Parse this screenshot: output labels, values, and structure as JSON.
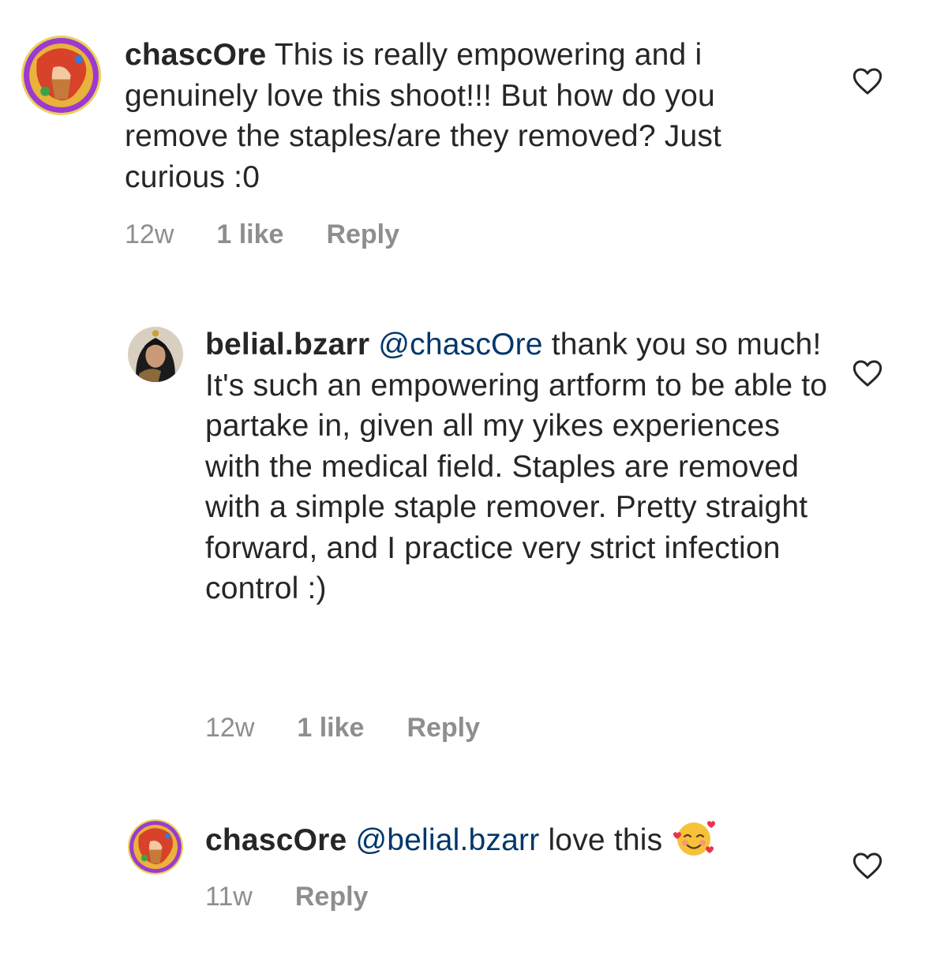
{
  "comments": [
    {
      "username": "chascOre",
      "text": "This is really empowering and i genuinely love this shoot!!! But how do you remove the staples/are they removed? Just curious :0",
      "time": "12w",
      "likes": "1 like",
      "reply_label": "Reply"
    },
    {
      "username": "belial.bzarr",
      "mention": "@chascOre",
      "text": "thank you so much! It's such an empowering artform to be able to partake in, given all my yikes experiences with the medical field. Staples are removed with a simple staple remover. Pretty straight forward, and I practice very strict infection control :)",
      "time": "12w",
      "likes": "1 like",
      "reply_label": "Reply"
    },
    {
      "username": "chascOre",
      "mention": "@belial.bzarr",
      "text": "love this",
      "emoji": "smiling-face-with-hearts",
      "time": "11w",
      "reply_label": "Reply"
    }
  ],
  "icons": {
    "like": "heart-outline-icon"
  },
  "colors": {
    "text": "#262626",
    "meta": "#8e8e8e",
    "mention": "#00376b"
  }
}
